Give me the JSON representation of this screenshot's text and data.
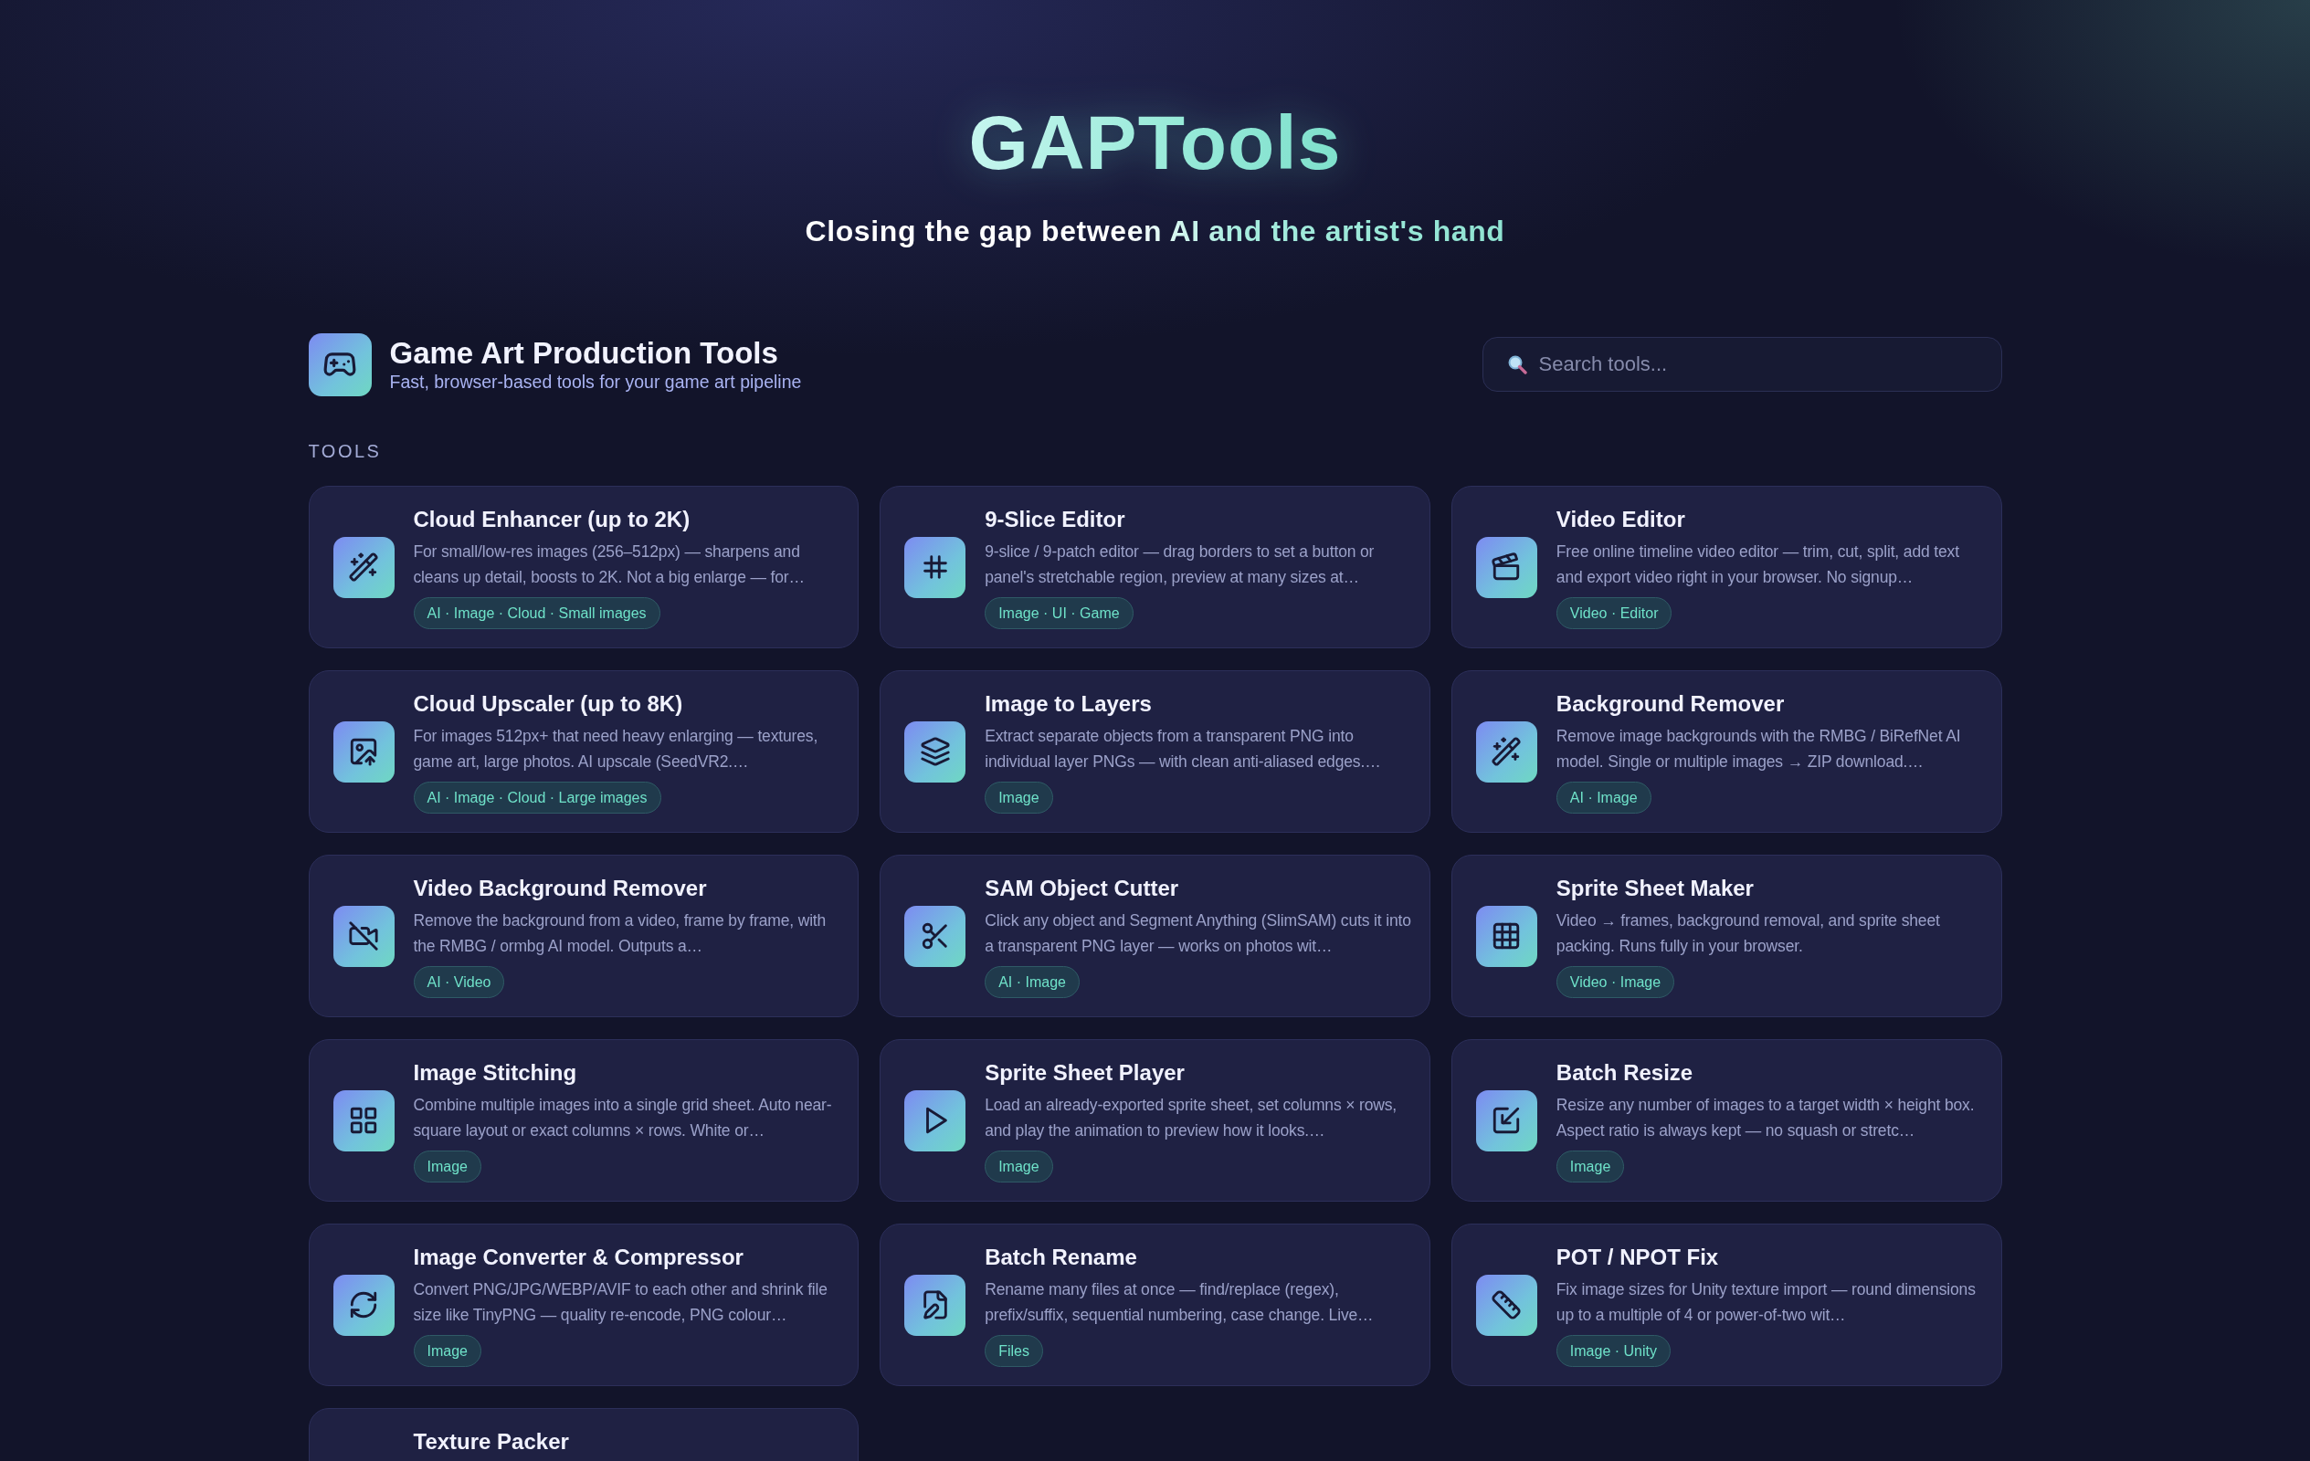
{
  "hero": {
    "title": "GAPTools",
    "tagline": "Closing the gap between AI and the artist's hand"
  },
  "header": {
    "title": "Game Art Production Tools",
    "subtitle": "Fast, browser-based tools for your game art pipeline"
  },
  "search": {
    "placeholder": "Search tools..."
  },
  "section_label": "TOOLS",
  "tools": [
    {
      "title": "Cloud Enhancer (up to 2K)",
      "description": "For small/low-res images (256–512px) — sharpens and cleans up detail, boosts to 2K. Not a big enlarge — for…",
      "tags": "AI · Image · Cloud · Small images"
    },
    {
      "title": "9-Slice Editor",
      "description": "9-slice / 9-patch editor — drag borders to set a button or panel's stretchable region, preview at many sizes at…",
      "tags": "Image · UI · Game"
    },
    {
      "title": "Video Editor",
      "description": "Free online timeline video editor — trim, cut, split, add text and export video right in your browser. No signup…",
      "tags": "Video · Editor"
    },
    {
      "title": "Cloud Upscaler (up to 8K)",
      "description": "For images 512px+ that need heavy enlarging — textures, game art, large photos. AI upscale (SeedVR2.…",
      "tags": "AI · Image · Cloud · Large images"
    },
    {
      "title": "Image to Layers",
      "description": "Extract separate objects from a transparent PNG into individual layer PNGs — with clean anti-aliased edges.…",
      "tags": "Image"
    },
    {
      "title": "Background Remover",
      "description": "Remove image backgrounds with the RMBG / BiRefNet AI model. Single or multiple images → ZIP download.…",
      "tags": "AI · Image"
    },
    {
      "title": "Video Background Remover",
      "description": "Remove the background from a video, frame by frame, with the RMBG / ormbg AI model. Outputs a…",
      "tags": "AI · Video"
    },
    {
      "title": "SAM Object Cutter",
      "description": "Click any object and Segment Anything (SlimSAM) cuts it into a transparent PNG layer — works on photos wit…",
      "tags": "AI · Image"
    },
    {
      "title": "Sprite Sheet Maker",
      "description": "Video → frames, background removal, and sprite sheet packing. Runs fully in your browser.",
      "tags": "Video · Image"
    },
    {
      "title": "Image Stitching",
      "description": "Combine multiple images into a single grid sheet. Auto near-square layout or exact columns × rows. White or…",
      "tags": "Image"
    },
    {
      "title": "Sprite Sheet Player",
      "description": "Load an already-exported sprite sheet, set columns × rows, and play the animation to preview how it looks.…",
      "tags": "Image"
    },
    {
      "title": "Batch Resize",
      "description": "Resize any number of images to a target width × height box. Aspect ratio is always kept — no squash or stretc…",
      "tags": "Image"
    },
    {
      "title": "Image Converter & Compressor",
      "description": "Convert PNG/JPG/WEBP/AVIF to each other and shrink file size like TinyPNG — quality re-encode, PNG colour…",
      "tags": "Image"
    },
    {
      "title": "Batch Rename",
      "description": "Rename many files at once — find/replace (regex), prefix/suffix, sequential numbering, case change. Live…",
      "tags": "Files"
    },
    {
      "title": "POT / NPOT Fix",
      "description": "Fix image sizes for Unity texture import — round dimensions up to a multiple of 4 or power-of-two wit…",
      "tags": "Image · Unity"
    },
    {
      "title": "Texture Packer"
    }
  ]
}
